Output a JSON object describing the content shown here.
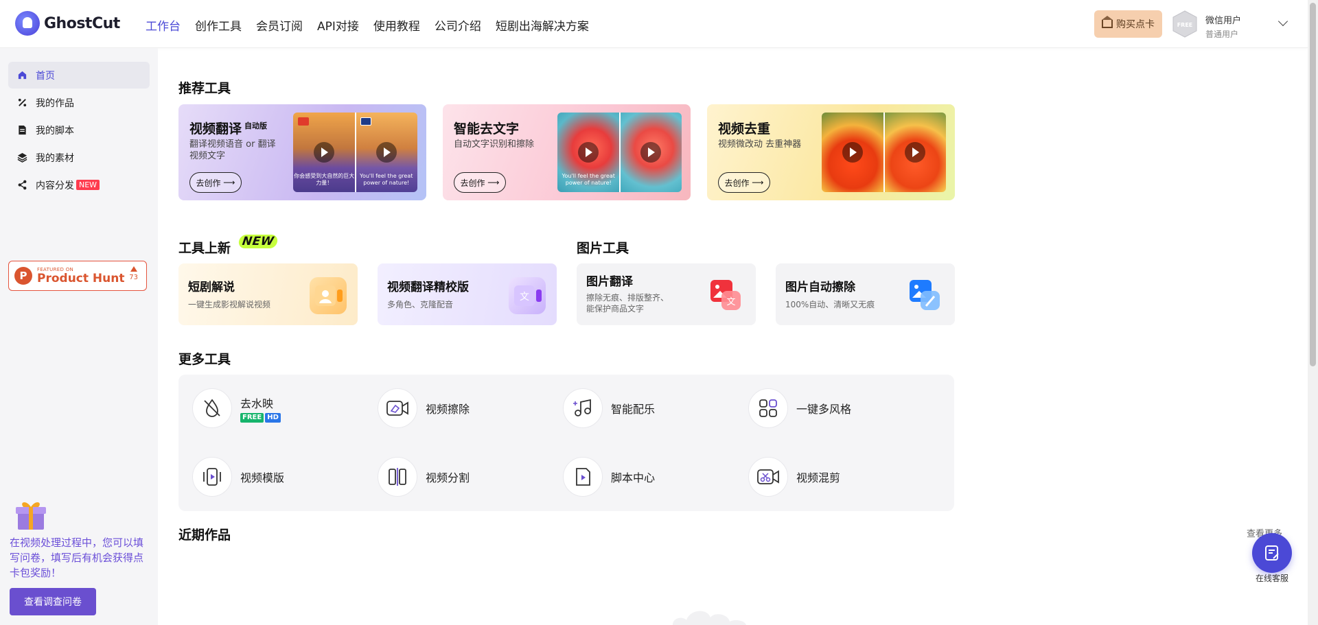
{
  "brand": {
    "name": "GhostCut"
  },
  "nav": {
    "items": [
      "工作台",
      "创作工具",
      "会员订阅",
      "API对接",
      "使用教程",
      "公司介绍",
      "短剧出海解决方案"
    ]
  },
  "header": {
    "buy_label": "购买点卡",
    "avatar_badge": "FREE",
    "user_name": "微信用户",
    "user_level": "普通用户"
  },
  "sidebar": {
    "items": [
      {
        "label": "首页",
        "icon": "home-icon",
        "active": true
      },
      {
        "label": "我的作品",
        "icon": "works-icon"
      },
      {
        "label": "我的脚本",
        "icon": "script-icon"
      },
      {
        "label": "我的素材",
        "icon": "layers-icon"
      },
      {
        "label": "内容分发",
        "icon": "share-icon",
        "badge": "NEW"
      }
    ],
    "product_hunt": {
      "featured": "FEATURED ON",
      "name": "Product Hunt",
      "votes": "73"
    },
    "survey_text": "在视频处理过程中，您可以填写问卷，填写后有机会获得点卡包奖励！",
    "survey_button": "查看调查问卷"
  },
  "recommended": {
    "title": "推荐工具",
    "cards": [
      {
        "title": "视频翻译",
        "tag": "自动版",
        "desc": "翻译视频语音 or 翻译视频文字",
        "button": "去创作",
        "caption_left": "你会感受到大自然的巨大力量！",
        "caption_right": "You'll feel the great power of nature!"
      },
      {
        "title": "智能去文字",
        "desc": "自动文字识别和擦除",
        "button": "去创作",
        "caption_left": "You'll feel the great power of nature!"
      },
      {
        "title": "视频去重",
        "desc": "视频微改动 去重神器",
        "button": "去创作"
      }
    ]
  },
  "new_tools": {
    "title": "工具上新",
    "new_tag": "NEW",
    "cards": [
      {
        "title": "短剧解说",
        "desc": "一键生成影视解说视频"
      },
      {
        "title": "视频翻译精校版",
        "desc": "多角色、克隆配音"
      }
    ]
  },
  "image_tools": {
    "title": "图片工具",
    "cards": [
      {
        "title": "图片翻译",
        "desc": "擦除无痕、排版整齐、能保护商品文字"
      },
      {
        "title": "图片自动擦除",
        "desc": "100%自动、清晰又无痕"
      }
    ]
  },
  "more_tools": {
    "title": "更多工具",
    "items": [
      {
        "label": "去水映",
        "icon": "watermark-remove-icon",
        "badges": [
          "FREE",
          "HD"
        ]
      },
      {
        "label": "视频擦除",
        "icon": "video-erase-icon"
      },
      {
        "label": "智能配乐",
        "icon": "music-icon"
      },
      {
        "label": "一键多风格",
        "icon": "grid-icon"
      },
      {
        "label": "视频模版",
        "icon": "template-icon"
      },
      {
        "label": "视频分割",
        "icon": "split-icon"
      },
      {
        "label": "脚本中心",
        "icon": "script-center-icon"
      },
      {
        "label": "视频混剪",
        "icon": "video-mix-icon"
      }
    ]
  },
  "recent": {
    "title": "近期作品",
    "view_more": "查看更多"
  },
  "support": {
    "label": "在线客服"
  },
  "colors": {
    "accent": "#4b49d6",
    "survey": "#6a4fcf",
    "product_hunt": "#da552f",
    "new_badge": "#ff3b4e"
  }
}
